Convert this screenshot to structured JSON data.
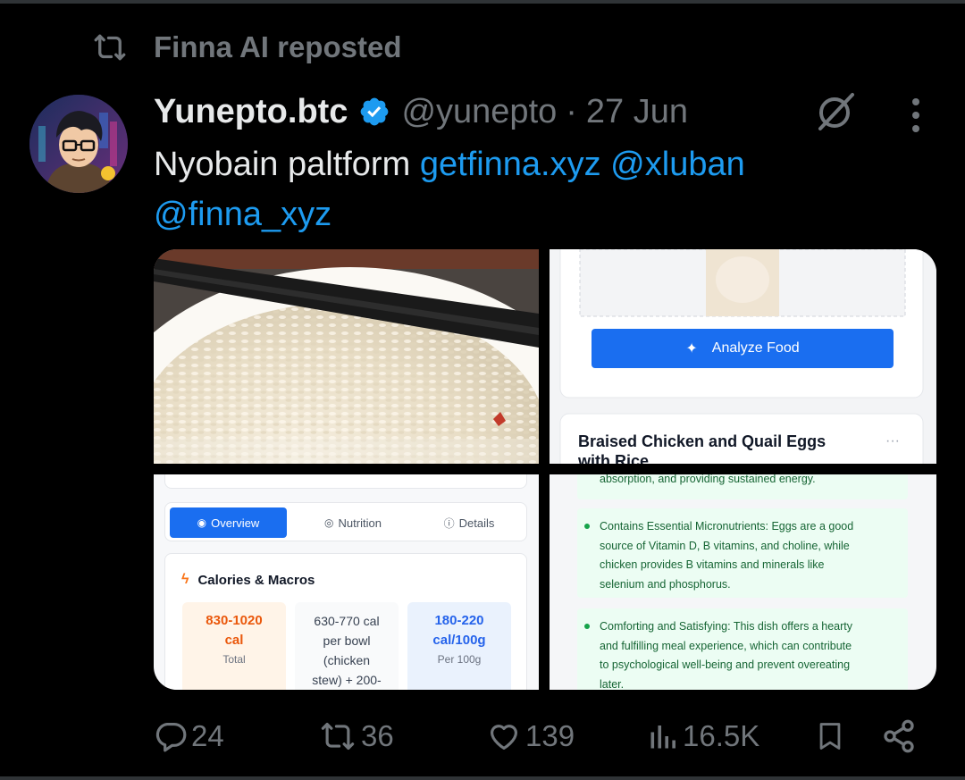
{
  "repost": {
    "text": "Finna AI reposted",
    "icon": "repost-icon"
  },
  "author": {
    "name": "Yunepto.btc",
    "handle": "@yunepto",
    "separator": "·",
    "date": "27 Jun",
    "verified": true,
    "badge_color": "#1d9bf0"
  },
  "tweet": {
    "text_plain": "Nyobain paltform ",
    "link": "getfinna.xyz",
    "mention1": "@xluban",
    "mention2": "@finna_xyz"
  },
  "media": {
    "image2": {
      "button_label": "Analyze Food",
      "card_title": "Braised Chicken and Quail Eggs",
      "card_title_line2": "with Rice",
      "menu": "···"
    },
    "image3": {
      "tabs": [
        {
          "label": "Overview",
          "active": true
        },
        {
          "label": "Nutrition",
          "active": false
        },
        {
          "label": "Details",
          "active": false
        }
      ],
      "section_title": "Calories & Macros",
      "stats": [
        {
          "line1": "830-1020",
          "line2": "cal",
          "line3": "Total"
        },
        {
          "line1": "630-770 cal",
          "line2": "per bowl",
          "line3": "(chicken",
          "line4": "stew) + 200-"
        },
        {
          "line1": "180-220",
          "line2": "cal/100g",
          "line3": "Per 100g"
        }
      ]
    },
    "image4": {
      "bullets": [
        {
          "lines": [
            "absorption, and providing sustained energy."
          ]
        },
        {
          "lines": [
            "Contains Essential Micronutrients: Eggs are a good",
            "source of Vitamin D, B vitamins, and choline, while",
            "chicken provides B vitamins and minerals like",
            "selenium and phosphorus."
          ]
        },
        {
          "lines": [
            "Comforting and Satisfying: This dish offers a hearty",
            "and fulfilling meal experience, which can contribute",
            "to psychological well-being and prevent overeating",
            "later."
          ]
        }
      ]
    }
  },
  "actions": {
    "replies": "24",
    "reposts": "36",
    "likes": "139",
    "views": "16.5K"
  },
  "colors": {
    "background": "#000000",
    "text": "#e7e9ea",
    "muted": "#71767b",
    "link": "#1d9bf0",
    "app_blue": "#1a6ef0"
  }
}
